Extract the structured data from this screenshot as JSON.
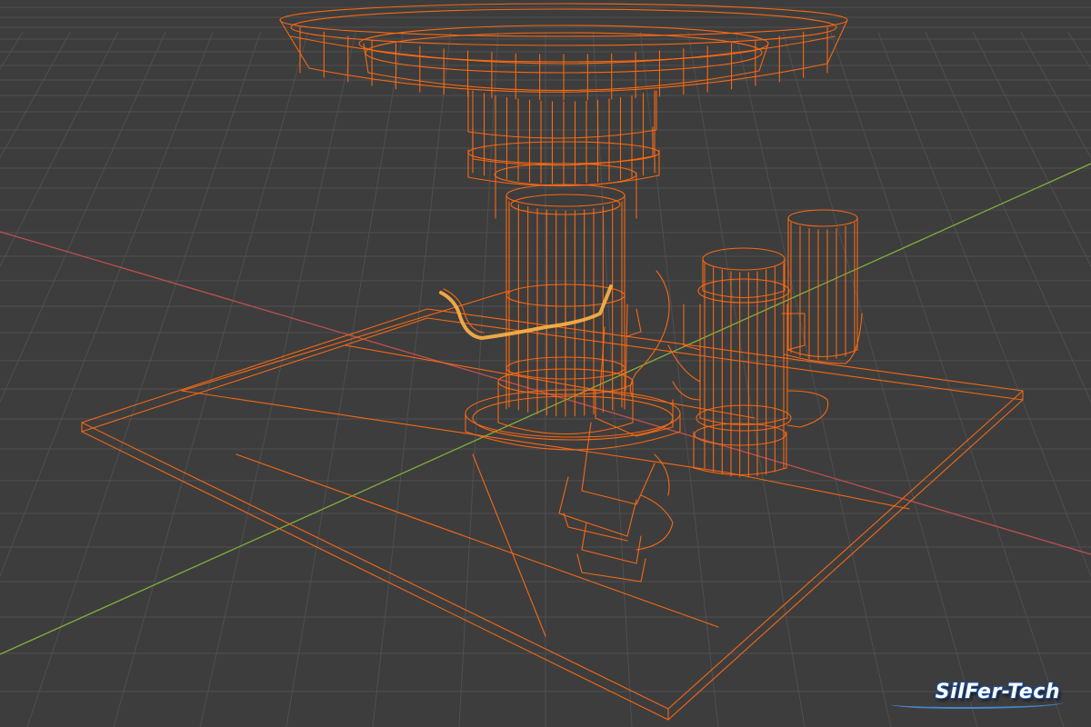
{
  "viewport": {
    "background_color": "#3d3d3d",
    "grid_color": "#4f4f4f",
    "x_axis_color": "#c0504d",
    "y_axis_color": "#7fae3a",
    "selection_color": "#ff6a13",
    "active_color": "#ffb347"
  },
  "watermark": {
    "text": "SilFer-Tech"
  }
}
